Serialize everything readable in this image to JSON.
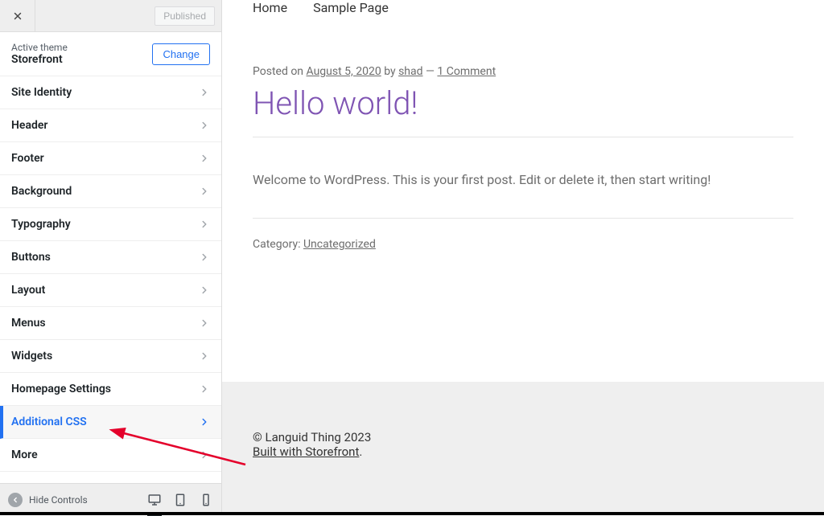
{
  "topbar": {
    "published_label": "Published"
  },
  "theme": {
    "label": "Active theme",
    "name": "Storefront",
    "change_label": "Change"
  },
  "panels": [
    {
      "label": "Site Identity",
      "active": false
    },
    {
      "label": "Header",
      "active": false
    },
    {
      "label": "Footer",
      "active": false
    },
    {
      "label": "Background",
      "active": false
    },
    {
      "label": "Typography",
      "active": false
    },
    {
      "label": "Buttons",
      "active": false
    },
    {
      "label": "Layout",
      "active": false
    },
    {
      "label": "Menus",
      "active": false
    },
    {
      "label": "Widgets",
      "active": false
    },
    {
      "label": "Homepage Settings",
      "active": false
    },
    {
      "label": "Additional CSS",
      "active": true
    },
    {
      "label": "More",
      "active": false
    }
  ],
  "bottombar": {
    "hide_label": "Hide Controls"
  },
  "preview": {
    "nav": {
      "home": "Home",
      "sample": "Sample Page"
    },
    "meta": {
      "posted_on": "Posted on ",
      "date": "August 5, 2020",
      "by": " by ",
      "author": "shad",
      "sep": " — ",
      "comment": "1 Comment"
    },
    "title": "Hello world!",
    "content": "Welcome to WordPress. This is your first post. Edit or delete it, then start writing!",
    "category_label": "Category: ",
    "category": "Uncategorized",
    "footer": {
      "copyright": "© Languid Thing 2023",
      "built": "Built with Storefront",
      "period": "."
    }
  }
}
